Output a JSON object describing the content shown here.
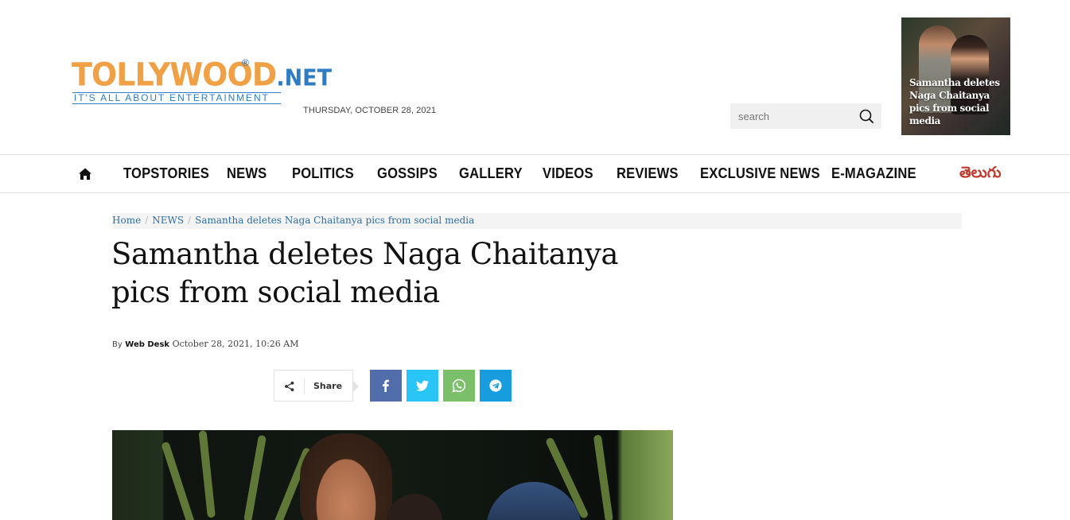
{
  "header": {
    "logo": {
      "main": "TOLLYWOOD",
      "suffix": ".NET",
      "registered": "®",
      "tagline": "IT'S ALL ABOUT ENTERTAINMENT"
    },
    "date": "THURSDAY, OCTOBER 28, 2021",
    "search": {
      "placeholder": "search",
      "icon": "search-icon"
    },
    "ad": {
      "caption": "Samantha deletes Naga Chaitanya pics from social media"
    }
  },
  "nav": {
    "home_icon": "home-icon",
    "items": [
      {
        "label": "TOPSTORIES"
      },
      {
        "label": "NEWS"
      },
      {
        "label": "POLITICS"
      },
      {
        "label": "GOSSIPS"
      },
      {
        "label": "GALLERY"
      },
      {
        "label": "VIDEOS"
      },
      {
        "label": "REVIEWS"
      },
      {
        "label": "EXCLUSIVE NEWS"
      },
      {
        "label": "E-MAGAZINE"
      }
    ],
    "language": "తెలుగు"
  },
  "article": {
    "breadcrumb": {
      "home": "Home",
      "section": "NEWS",
      "current": "Samantha deletes Naga Chaitanya pics from social media",
      "separator": "/"
    },
    "title": "Samantha deletes Naga Chaitanya pics from social media",
    "byline": {
      "prefix": "By",
      "author": "Web Desk",
      "datetime": "October 28, 2021, 10:26 AM"
    },
    "share": {
      "label": "Share",
      "icon": "share-icon",
      "buttons": [
        {
          "name": "facebook",
          "icon": "facebook-icon",
          "color": "#516eab"
        },
        {
          "name": "twitter",
          "icon": "twitter-icon",
          "color": "#29c5f6"
        },
        {
          "name": "whatsapp",
          "icon": "whatsapp-icon",
          "color": "#7bbf6a"
        },
        {
          "name": "telegram",
          "icon": "telegram-icon",
          "color": "#179cde"
        }
      ]
    }
  },
  "colors": {
    "logo_orange": "#f0a045",
    "logo_blue": "#2e7cc4",
    "link_blue": "#2e6da4",
    "telugu_red": "#c0392b"
  }
}
